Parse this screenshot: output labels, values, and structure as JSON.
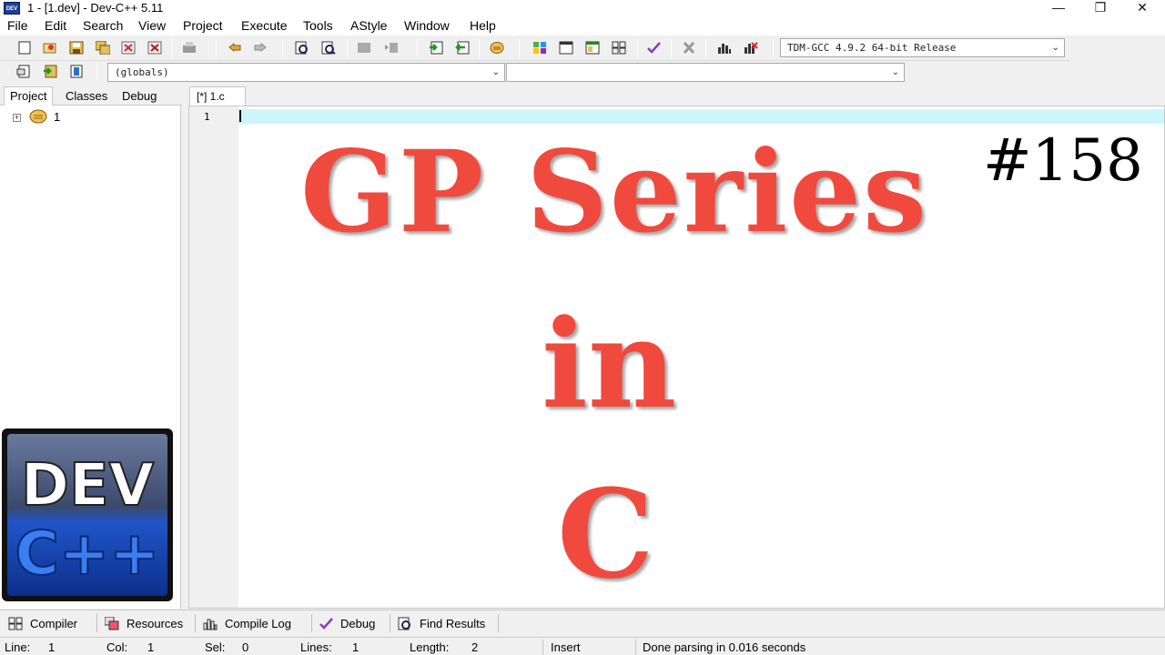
{
  "window": {
    "title": "1 - [1.dev] - Dev-C++ 5.11",
    "app_icon_text": "DEV",
    "minimize": "—",
    "restore": "❐",
    "close": "✕"
  },
  "menu": [
    "File",
    "Edit",
    "Search",
    "View",
    "Project",
    "Execute",
    "Tools",
    "AStyle",
    "Window",
    "Help"
  ],
  "toolbar": {
    "compiler_select": "TDM-GCC 4.9.2 64-bit Release",
    "globals_select": "(globals)",
    "members_select": ""
  },
  "left_panel": {
    "tabs": [
      "Project",
      "Classes",
      "Debug"
    ],
    "tree_root": "1",
    "tree_expander": "+"
  },
  "editor": {
    "tab_label": "[*] 1.c",
    "line_number": "1"
  },
  "overlay": {
    "title": "GP Series",
    "in": "in",
    "lang": "C",
    "number": "#158"
  },
  "logo": {
    "line1": "DEV",
    "line2": "C++"
  },
  "bottom_tabs": [
    "Compiler",
    "Resources",
    "Compile Log",
    "Debug",
    "Find Results"
  ],
  "status": {
    "line_label": "Line:",
    "line": "1",
    "col_label": "Col:",
    "col": "1",
    "sel_label": "Sel:",
    "sel": "0",
    "lines_label": "Lines:",
    "lines": "1",
    "length_label": "Length:",
    "length": "2",
    "mode": "Insert",
    "message": "Done parsing in 0.016 seconds"
  },
  "colors": {
    "overlay_text": "#f04a3e",
    "active_line": "#ccf7fa",
    "logo_blue": "#1f55c8"
  }
}
